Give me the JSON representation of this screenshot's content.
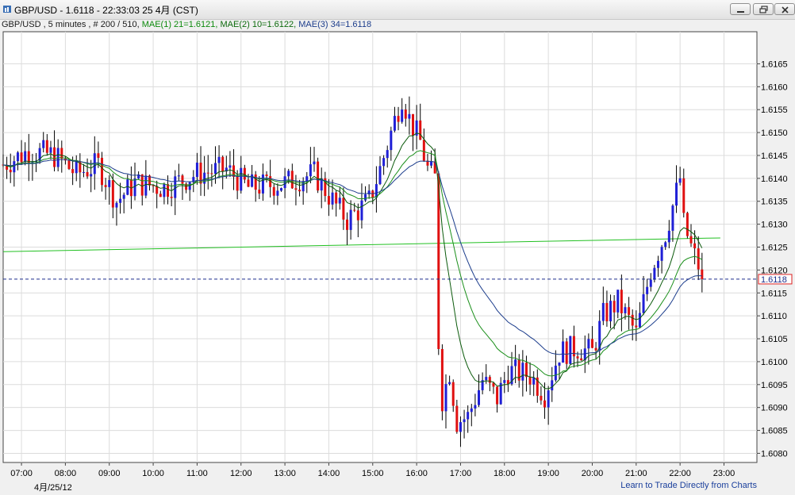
{
  "window": {
    "title": "GBP/USD - 1.6118 - 22:33:03  25 4月 (CST)"
  },
  "infobar": {
    "symbol": "GBP/USD , 5 minutes , # 200 / 510,",
    "mae1": "MAE(1) 21=1.6121,",
    "mae2": "MAE(2) 10=1.6122,",
    "mae3": "MAE(3) 34=1.6118"
  },
  "footer": {
    "date": "4月/25/12",
    "link": "Learn to Trade Directly from Charts"
  },
  "colors": {
    "up": "#1f1fd6",
    "down": "#e01010",
    "mae1": "#1a8f1a",
    "mae2": "#0b5a0b",
    "mae3": "#1c3d8c",
    "trend": "#22c022",
    "current_line": "#1c2f8c"
  },
  "chart_data": {
    "type": "candlestick",
    "symbol": "GBP/USD",
    "interval": "5 minutes",
    "last_price": 1.6118,
    "last_label": "1.6118",
    "ylim": [
      1.6078,
      1.6172
    ],
    "y_ticks": [
      "1.6080",
      "1.6085",
      "1.6090",
      "1.6095",
      "1.6100",
      "1.6105",
      "1.6110",
      "1.6115",
      "1.6120",
      "1.6125",
      "1.6130",
      "1.6135",
      "1.6140",
      "1.6145",
      "1.6150",
      "1.6155",
      "1.6160",
      "1.6165"
    ],
    "x_tick_labels": [
      "07:00",
      "08:00",
      "09:00",
      "10:00",
      "11:00",
      "12:00",
      "13:00",
      "14:00",
      "15:00",
      "16:00",
      "17:00",
      "18:00",
      "19:00",
      "20:00",
      "21:00",
      "22:00",
      "23:00"
    ],
    "x_start": "06:35",
    "grid": true,
    "moving_averages": [
      {
        "name": "MAE(1) 21",
        "value": 1.6121
      },
      {
        "name": "MAE(2) 10",
        "value": 1.6122
      },
      {
        "name": "MAE(3) 34",
        "value": 1.6118
      }
    ],
    "trend_line": {
      "start": [
        "06:35",
        1.6124
      ],
      "end": [
        "22:55",
        1.6127
      ]
    },
    "anchors": [
      [
        "06:35",
        1.6143
      ],
      [
        "07:10",
        1.6146
      ],
      [
        "07:45",
        1.6145
      ],
      [
        "08:15",
        1.6141
      ],
      [
        "08:45",
        1.6143
      ],
      [
        "09:10",
        1.6135
      ],
      [
        "09:35",
        1.6139
      ],
      [
        "10:15",
        1.6138
      ],
      [
        "11:00",
        1.6141
      ],
      [
        "11:40",
        1.6142
      ],
      [
        "12:10",
        1.6138
      ],
      [
        "13:00",
        1.6139
      ],
      [
        "13:40",
        1.6141
      ],
      [
        "14:10",
        1.6134
      ],
      [
        "14:25",
        1.6131
      ],
      [
        "14:55",
        1.6135
      ],
      [
        "15:10",
        1.6142
      ],
      [
        "15:25",
        1.615
      ],
      [
        "15:40",
        1.6158
      ],
      [
        "15:50",
        1.6153
      ],
      [
        "16:05",
        1.6148
      ],
      [
        "16:15",
        1.6142
      ],
      [
        "16:25",
        1.614
      ],
      [
        "16:32",
        1.609
      ],
      [
        "16:45",
        1.6098
      ],
      [
        "16:55",
        1.6087
      ],
      [
        "17:10",
        1.6088
      ],
      [
        "17:30",
        1.6096
      ],
      [
        "17:50",
        1.6092
      ],
      [
        "18:05",
        1.6098
      ],
      [
        "18:35",
        1.6097
      ],
      [
        "18:55",
        1.6093
      ],
      [
        "19:15",
        1.6102
      ],
      [
        "19:40",
        1.6103
      ],
      [
        "20:00",
        1.6102
      ],
      [
        "20:15",
        1.611
      ],
      [
        "20:35",
        1.6113
      ],
      [
        "20:50",
        1.6109
      ],
      [
        "21:00",
        1.6106
      ],
      [
        "21:20",
        1.612
      ],
      [
        "21:40",
        1.6128
      ],
      [
        "22:00",
        1.614
      ],
      [
        "22:05",
        1.613
      ],
      [
        "22:15",
        1.6125
      ],
      [
        "22:25",
        1.6121
      ],
      [
        "22:30",
        1.6118
      ]
    ]
  }
}
